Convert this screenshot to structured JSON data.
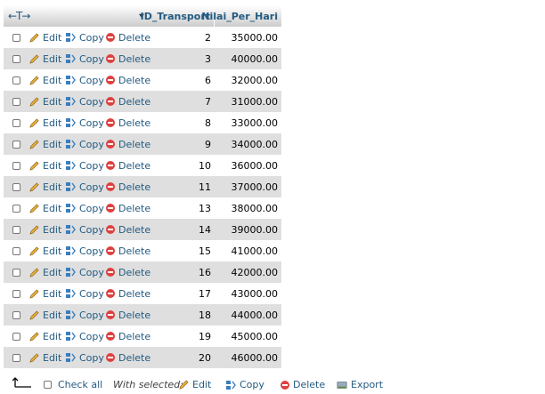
{
  "header": {
    "arrows": "←T→",
    "col_id": "ID_Transport",
    "col_nilai": "Nilai_Per_Hari"
  },
  "row_actions": {
    "edit": "Edit",
    "copy": "Copy",
    "delete": "Delete"
  },
  "rows": [
    {
      "id": "2",
      "nilai": "35000.00"
    },
    {
      "id": "3",
      "nilai": "40000.00"
    },
    {
      "id": "6",
      "nilai": "32000.00"
    },
    {
      "id": "7",
      "nilai": "31000.00"
    },
    {
      "id": "8",
      "nilai": "33000.00"
    },
    {
      "id": "9",
      "nilai": "34000.00"
    },
    {
      "id": "10",
      "nilai": "36000.00"
    },
    {
      "id": "11",
      "nilai": "37000.00"
    },
    {
      "id": "13",
      "nilai": "38000.00"
    },
    {
      "id": "14",
      "nilai": "39000.00"
    },
    {
      "id": "15",
      "nilai": "41000.00"
    },
    {
      "id": "16",
      "nilai": "42000.00"
    },
    {
      "id": "17",
      "nilai": "43000.00"
    },
    {
      "id": "18",
      "nilai": "44000.00"
    },
    {
      "id": "19",
      "nilai": "45000.00"
    },
    {
      "id": "20",
      "nilai": "46000.00"
    }
  ],
  "footer": {
    "check_all": "Check all",
    "with_selected": "With selected:",
    "edit": "Edit",
    "copy": "Copy",
    "delete": "Delete",
    "export": "Export"
  }
}
